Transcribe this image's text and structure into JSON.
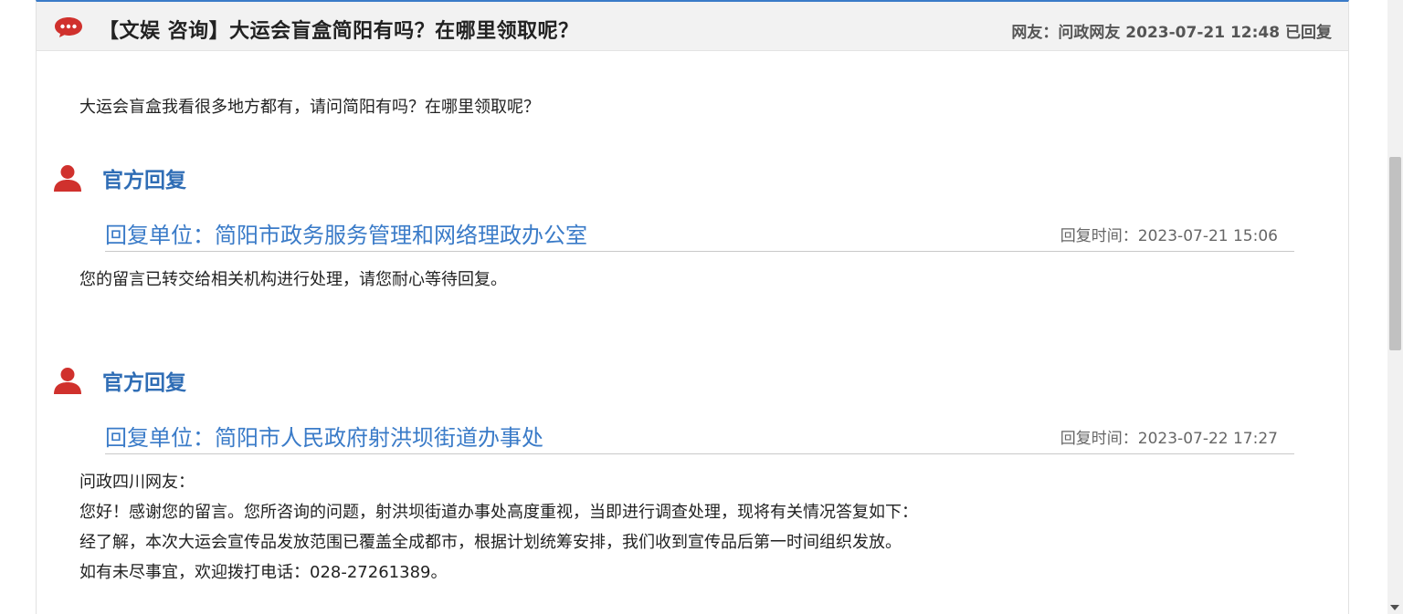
{
  "header": {
    "title": "【文娱 咨询】大运会盲盒简阳有吗？在哪里领取呢？",
    "meta": "网友：问政网友  2023-07-21 12:48 已回复"
  },
  "question": "大运会盲盒我看很多地方都有，请问简阳有吗？在哪里领取呢？",
  "replies": [
    {
      "label": "官方回复",
      "unit": "回复单位：简阳市政务服务管理和网络理政办公室",
      "time": "回复时间：2023-07-21 15:06",
      "lines": [
        "您的留言已转交给相关机构进行处理，请您耐心等待回复。"
      ]
    },
    {
      "label": "官方回复",
      "unit": "回复单位：简阳市人民政府射洪坝街道办事处",
      "time": "回复时间：2023-07-22 17:27",
      "lines": [
        "问政四川网友：",
        "您好！感谢您的留言。您所咨询的问题，射洪坝街道办事处高度重视，当即进行调查处理，现将有关情况答复如下：",
        "经了解，本次大运会宣传品发放范围已覆盖全成都市，根据计划统筹安排，我们收到宣传品后第一时间组织发放。",
        "如有未尽事宜，欢迎拨打电话：028-27261389。"
      ]
    }
  ],
  "icons": {
    "chat": "chat-bubble-icon",
    "person": "person-icon"
  },
  "colors": {
    "accent_blue": "#2f6db5",
    "link_blue": "#3a7bc8",
    "icon_red": "#d0312d",
    "header_bg": "#f2f2f2"
  }
}
